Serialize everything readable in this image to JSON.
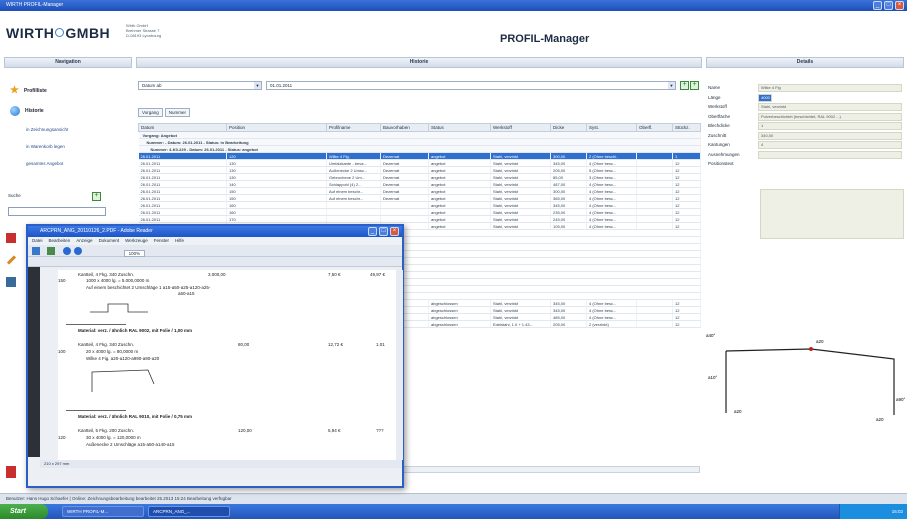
{
  "window": {
    "title": "WIRTH PROFIL-Manager"
  },
  "company": {
    "logo_left": "WIRTH",
    "logo_right": "GMBH",
    "address": [
      "Wirth GmbH",
      "Brehmer Strasse 7",
      "D-08193 Lyonbourg"
    ]
  },
  "app_title": "PROFIL-Manager",
  "nav": {
    "header": "Navigation",
    "items": [
      {
        "label": "Profilliste",
        "icon": "star-icon"
      },
      {
        "label": "Historie",
        "icon": "globe-icon"
      }
    ],
    "sub_items": [
      "in Zeichnungsansicht",
      "in Warenkorb legen",
      "gesamtes Angebot"
    ],
    "search_label": "Suche"
  },
  "history": {
    "header": "Historie",
    "date_filter": "Datum ab",
    "date_value": "01.01.2011",
    "group_buttons": [
      "Vorgang",
      "Nummer"
    ],
    "columns": [
      "Datum",
      "Position",
      "Profilname",
      "Bauvorhaben",
      "Status",
      "Werkstoff",
      "Dicke",
      "Syst.",
      "Oberfl.",
      "Stückz."
    ],
    "group_lines": [
      "Vorgang: Angebot",
      "Nummer: - Datum: 26.01.2011 - Status: in Bearbeitung",
      "Nummer: 4-K0-229 - Datum: 26.01.2011 - Status: angebot"
    ],
    "rows": [
      [
        "26.01.2011",
        "120",
        "Wilke 4 Fig.",
        "Dezernat",
        "angebot",
        "Stahl, verzinkt",
        "300,00",
        "2 (Ohne beschi..",
        "",
        "1"
      ],
      [
        "26.01.2011",
        "130",
        "Umfalzkante - beva...",
        "Dezernat",
        "angebot",
        "Stahl, verzinkt",
        "345,00",
        "4 (Ohne besc...",
        "",
        "12"
      ],
      [
        "26.01.2011",
        "130",
        "Außenecke 2 Umsc...",
        "Dezernat",
        "angebot",
        "Stahl, verzinkt",
        "205,00",
        "5 (Ohne besc...",
        "",
        "12"
      ],
      [
        "26.01.2011",
        "130",
        "Gebrochene 2 Um...",
        "Dezernat",
        "angebot",
        "Stahl, verzinkt",
        "85,00",
        "3 (Ohne besc...",
        "",
        "12"
      ],
      [
        "26.01.2011",
        "140",
        "Schlappohl (4) 2...",
        "Dezernat",
        "angebot",
        "Stahl, verzinkt",
        "487,00",
        "4 (Ohne besc...",
        "",
        "12"
      ],
      [
        "26.01.2011",
        "150",
        "Auf einem beschr...",
        "Dezernat",
        "angebot",
        "Stahl, verzinkt",
        "300,00",
        "4 (Ohne besc...",
        "",
        "12"
      ],
      [
        "26.01.2011",
        "150",
        "Auf einem beschr...",
        "Dezernat",
        "angebot",
        "Stahl, verzinkt",
        "365,00",
        "4 (Ohne besc...",
        "",
        "12"
      ],
      [
        "26.01.2011",
        "160",
        "",
        "",
        "angebot",
        "Stahl, verzinkt",
        "345,00",
        "4 (Ohne besc...",
        "",
        "12"
      ],
      [
        "26.01.2011",
        "160",
        "",
        "",
        "angebot",
        "Stahl, verzinkt",
        "235,00",
        "4 (Ohne besc...",
        "",
        "12"
      ],
      [
        "26.01.2011",
        "170",
        "",
        "",
        "angebot",
        "Stahl, verzinkt",
        "245,00",
        "4 (Ohne besc...",
        "",
        "12"
      ],
      [
        "26.01.2011",
        "170",
        "",
        "",
        "angebot",
        "Stahl, verzinkt",
        "105,00",
        "4 (Ohne besc...",
        "",
        "12"
      ]
    ],
    "rows_lower": [
      [
        "",
        "",
        "",
        "",
        "abgeschlossen",
        "Stahl, verzinkt",
        "345,00",
        "4 (Ohne besc...",
        "",
        "12"
      ],
      [
        "",
        "",
        "",
        "",
        "abgeschlossen",
        "Stahl, verzinkt",
        "345,00",
        "4 (Ohne besc...",
        "",
        "12"
      ],
      [
        "",
        "",
        "",
        "",
        "abgeschlossen",
        "Stahl, verzinkt",
        "485,00",
        "4 (Ohne besc...",
        "",
        "12"
      ],
      [
        "",
        "",
        "",
        "",
        "abgeschlossen",
        "Edelstahl, 1.0 + 1.43...",
        "205,00",
        "2 (verzinkt)",
        "",
        "12"
      ]
    ]
  },
  "details": {
    "header": "Details",
    "fields": [
      {
        "label": "Name",
        "value": "Wilke 4 Fig"
      },
      {
        "label": "Länge",
        "value": "4000"
      },
      {
        "label": "Werkstoff",
        "value": "Stahl, verzinkt"
      },
      {
        "label": "Oberfläche",
        "value": "Pulverbeschichtet (beschichtet, RAL 9002 ...)"
      },
      {
        "label": "Blechdicke",
        "value": "1"
      },
      {
        "label": "Zuschnitt",
        "value": "340,00"
      },
      {
        "label": "Kantungen",
        "value": "4"
      },
      {
        "label": "Ausnehmungen",
        "value": ""
      },
      {
        "label": "Positionstext",
        "value": ""
      }
    ],
    "sketch_labels": [
      "a40°",
      "a20",
      "a10°",
      "a20",
      "a90°",
      "a20"
    ]
  },
  "acrobat": {
    "title": "ARCPRN_ANG_20110126_2.PDF - Adobe Reader",
    "menu": [
      "Datei",
      "Bearbeiten",
      "Anzeige",
      "Dokument",
      "Werkzeuge",
      "Fenster",
      "Hilfe"
    ],
    "zoom": "100%",
    "page_size": "210 x 297 mm",
    "doc": {
      "top_pos": "150",
      "top_line1": "Kantteil, 4 Fkg. 340 Zuschn.",
      "top_line1_price": "3.000,00",
      "top_line1_ep": "7,50 €",
      "top_line1_gp": "49,97 €",
      "top_line2": "1000 x 4000 lg. = 5.000,0000 m",
      "top_line3": "Auf einem beschichtet 2 Umschläge 1 a15-a50-a25-a120-a25-",
      "top_line4": "a50-a15",
      "material1": "Material: verz. / ähnlich RAL 9002, mit Folie / 1,00 mm",
      "pos2": "100",
      "pos2_line1": "Kantteil, 4 Fkg. 340 Zuschn.",
      "pos2_qty": "80,00",
      "pos2_ep": "12,72 €",
      "pos2_gp": "1.01",
      "pos2_line2": "20 x 4000 lg. = 80,0000 m",
      "pos2_line3": "Wilke 4 Fig. a20-a120-a990-a90-a20",
      "material2": "Material: verz. / ähnlich RAL 9010, mit Folie / 0,75 mm",
      "pos3": "120",
      "pos3_line1": "Kantteil, 5 Fkg. 200 Zuschn.",
      "pos3_qty": "120,00",
      "pos3_ep": "5,94 €",
      "pos3_gp": "???",
      "pos3_line2": "30 x 4000 lg. = 120,0000 m",
      "pos3_line3": "Außenecke 2 Umschläge a15-a50-a140-a15"
    }
  },
  "status": {
    "text": "Benutzer: Hans Hugo Schaefer | Online: Zeichnungsbearbeitung bearbeitet 25.2013 15:24 Bearbeitung verfügbar"
  },
  "taskbar": {
    "start": "Start",
    "tasks": [
      "WIRTH PROFIL-M...",
      "ARCPRN_ANG_..."
    ],
    "clock": "16:02"
  }
}
